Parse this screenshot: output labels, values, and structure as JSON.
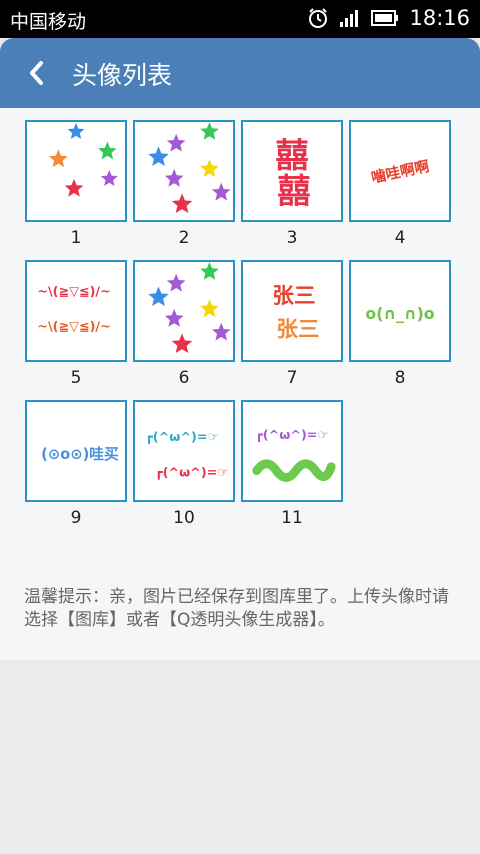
{
  "status_bar": {
    "carrier": "中国移动",
    "time": "18:16",
    "icons": [
      "alarm-icon",
      "signal-icon",
      "battery-icon"
    ]
  },
  "app_bar": {
    "back_icon": "back-arrow-icon",
    "title": "头像列表",
    "color": "#4a7fb7"
  },
  "avatars": [
    {
      "number": "1",
      "art": "stars"
    },
    {
      "number": "2",
      "art": "stars"
    },
    {
      "number": "3",
      "art": "text",
      "text": "囍囍"
    },
    {
      "number": "4",
      "art": "text",
      "text": "噛哇啊啊"
    },
    {
      "number": "5",
      "art": "text",
      "text": "~\\(≧▽≦)/~"
    },
    {
      "number": "6",
      "art": "stars"
    },
    {
      "number": "7",
      "art": "text",
      "text": "张三"
    },
    {
      "number": "8",
      "art": "text",
      "text": "o(∩_∩)o"
    },
    {
      "number": "9",
      "art": "text",
      "text": "(⊙o⊙)哇买"
    },
    {
      "number": "10",
      "art": "text",
      "text": "┏(^ω^)=☞"
    },
    {
      "number": "11",
      "art": "text",
      "text": "┏(^ω^)=☞"
    }
  ],
  "tip": "温馨提示：亲，图片已经保存到图库里了。上传头像时请选择【图库】或者【Q透明头像生成器】。"
}
